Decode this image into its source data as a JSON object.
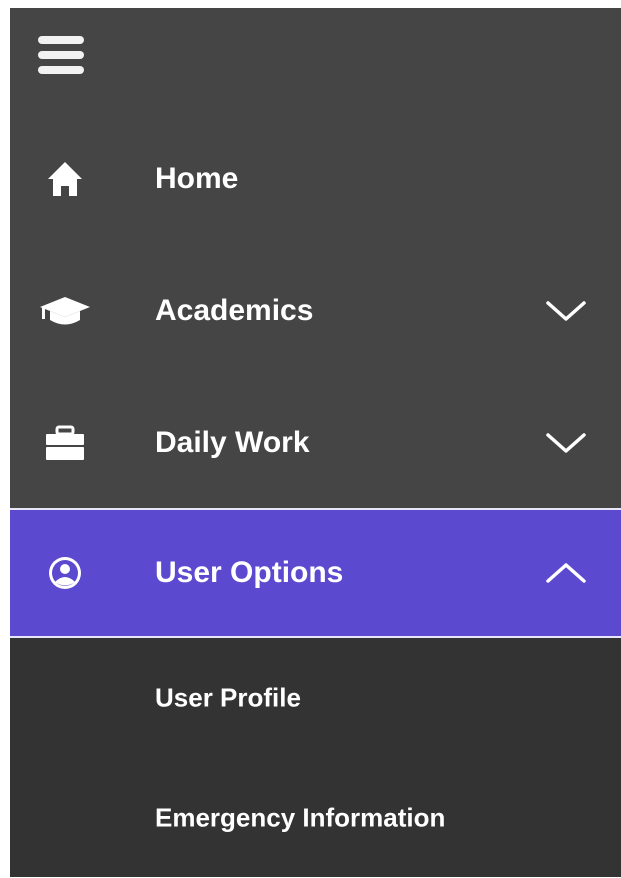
{
  "colors": {
    "sidebar_bg": "#454545",
    "submenu_bg": "#333333",
    "active_bg": "#5b4acf",
    "text": "#ffffff"
  },
  "menu_toggle": {
    "icon": "hamburger-icon"
  },
  "nav": {
    "items": [
      {
        "label": "Home",
        "icon": "home-icon"
      },
      {
        "label": "Academics",
        "icon": "graduation-cap-icon",
        "chevron": "chevron-down-icon"
      },
      {
        "label": "Daily Work",
        "icon": "briefcase-icon",
        "chevron": "chevron-down-icon"
      },
      {
        "label": "User Options",
        "icon": "user-circle-icon",
        "chevron": "chevron-up-icon",
        "expanded": true
      }
    ]
  },
  "submenu": {
    "items": [
      {
        "label": "User Profile"
      },
      {
        "label": "Emergency Information"
      }
    ]
  }
}
